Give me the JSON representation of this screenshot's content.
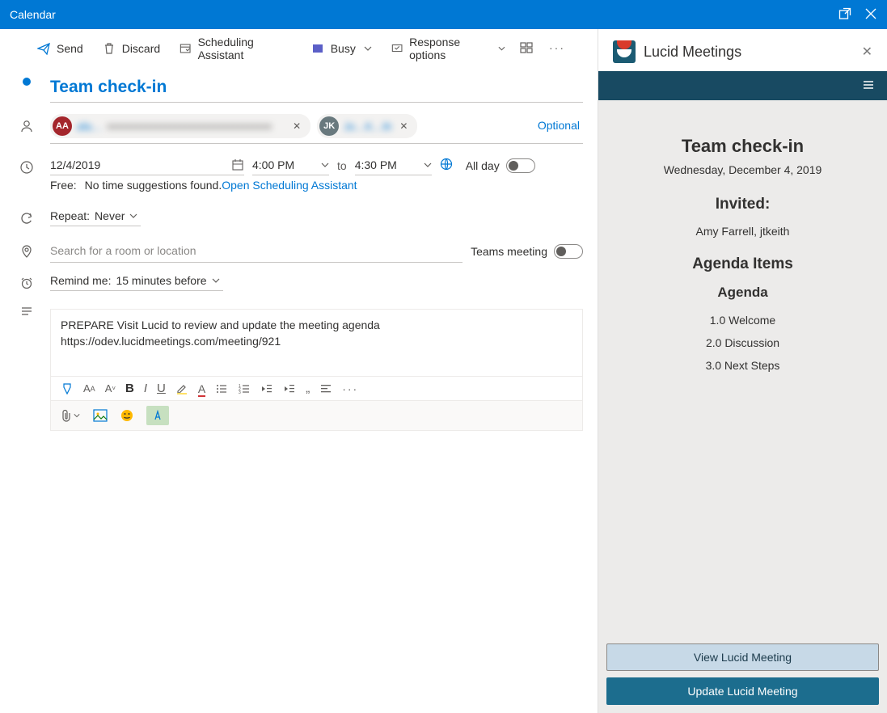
{
  "window": {
    "title": "Calendar"
  },
  "toolbar": {
    "send": "Send",
    "discard": "Discard",
    "scheduling": "Scheduling Assistant",
    "busy": "Busy",
    "response": "Response options"
  },
  "event": {
    "title": "Team check-in",
    "attendees": [
      {
        "initials": "AA",
        "name": "afa…",
        "avatarClass": "av-red"
      },
      {
        "initials": "JK",
        "name": "Jo…K…th",
        "avatarClass": "av-gray"
      }
    ],
    "optional_label": "Optional",
    "date": "12/4/2019",
    "start_time": "4:00 PM",
    "to_label": "to",
    "end_time": "4:30 PM",
    "all_day_label": "All day",
    "all_day": false,
    "freebusy": {
      "label": "Free:",
      "text": "No time suggestions found.",
      "link": "Open Scheduling Assistant"
    },
    "repeat_label": "Repeat:",
    "repeat_value": "Never",
    "location_placeholder": "Search for a room or location",
    "teams_label": "Teams meeting",
    "teams_on": false,
    "remind_label": "Remind me:",
    "remind_value": "15 minutes before",
    "body_line1": "PREPARE Visit Lucid to review and update the meeting agenda",
    "body_line2": "https://odev.lucidmeetings.com/meeting/921"
  },
  "panel": {
    "brand": "Lucid Meetings",
    "title": "Team check-in",
    "date": "Wednesday, December 4, 2019",
    "invited_label": "Invited:",
    "invited_names": "Amy Farrell, jtkeith",
    "agenda_header": "Agenda Items",
    "agenda_subheader": "Agenda",
    "items": [
      "1.0 Welcome",
      "2.0 Discussion",
      "3.0 Next Steps"
    ],
    "view_btn": "View Lucid Meeting",
    "update_btn": "Update Lucid Meeting"
  }
}
